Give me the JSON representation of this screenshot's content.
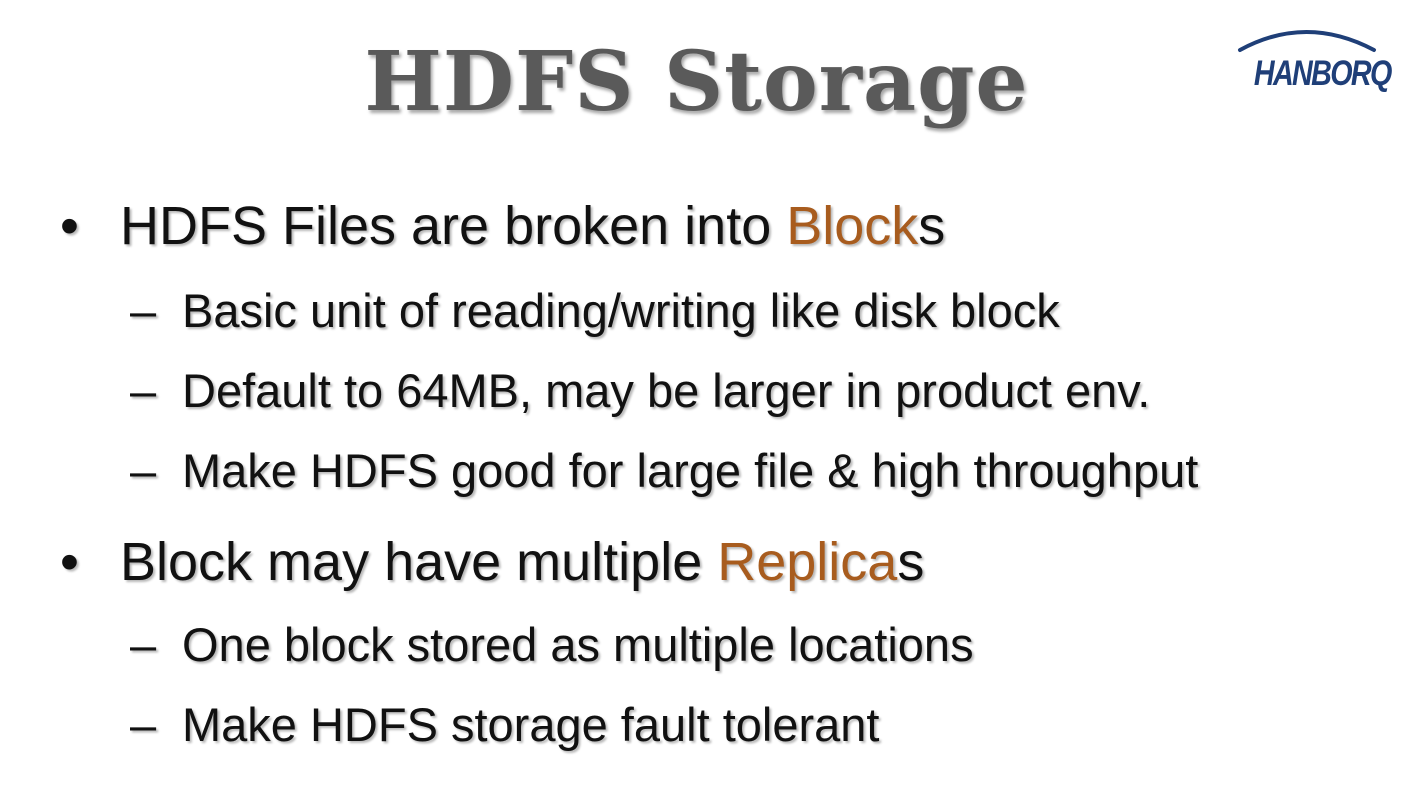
{
  "slide": {
    "title": "HDFS Storage",
    "logo_text": "HANBORQ",
    "colors": {
      "title": "#5a5a5a",
      "text": "#111111",
      "accent": "#a85c1e",
      "logo": "#1f3f78"
    },
    "bullets": [
      {
        "marker": "•",
        "text_before": "HDFS Files are broken into ",
        "highlight": "Block",
        "text_after": "s",
        "sub": [
          {
            "marker": "–",
            "text": "Basic unit of reading/writing like disk block"
          },
          {
            "marker": "–",
            "text": "Default to 64MB, may be larger in product env."
          },
          {
            "marker": "–",
            "text": "Make HDFS good for large file & high throughput"
          }
        ]
      },
      {
        "marker": "•",
        "text_before": "Block may have multiple ",
        "highlight": "Replica",
        "text_after": "s",
        "sub": [
          {
            "marker": "–",
            "text": "One block stored as multiple locations"
          },
          {
            "marker": "–",
            "text": "Make HDFS storage fault tolerant"
          }
        ]
      }
    ]
  }
}
